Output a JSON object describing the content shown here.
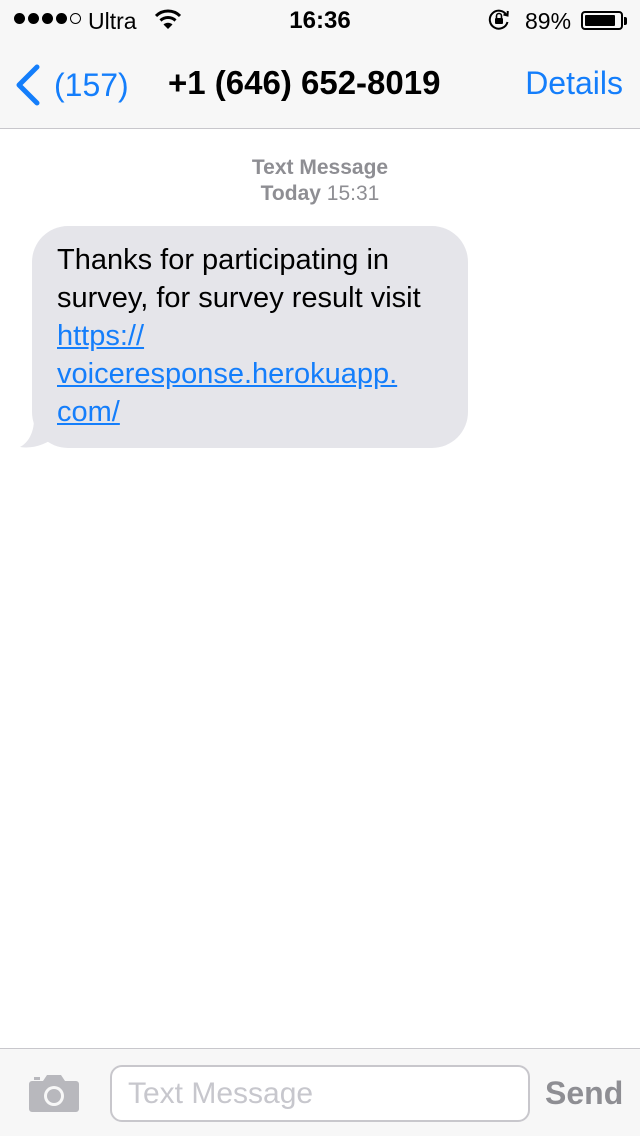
{
  "status_bar": {
    "carrier": "Ultra",
    "time": "16:36",
    "battery_percent": "89%",
    "battery_level": 0.89,
    "signal_bars_filled": 4,
    "signal_bars_total": 5
  },
  "nav": {
    "back_count": "(157)",
    "title": "+1 (646) 652-8019",
    "details_label": "Details"
  },
  "conversation": {
    "header_type": "Text Message",
    "header_day": "Today",
    "header_time": "15:31",
    "message": {
      "text": "Thanks for participating in survey, for survey result visit",
      "link_part1": "https://",
      "link_part2": "voiceresponse.herokuapp.",
      "link_part3": "com/"
    }
  },
  "input_bar": {
    "placeholder": "Text Message",
    "send_label": "Send"
  },
  "colors": {
    "accent": "#147efb",
    "bubble": "#e5e5ea",
    "muted": "#8e8e93",
    "bar": "#f7f7f7"
  },
  "icons": {
    "back": "chevron-left-icon",
    "camera": "camera-icon",
    "wifi": "wifi-icon",
    "rotation_lock": "rotation-lock-icon",
    "battery": "battery-icon"
  }
}
